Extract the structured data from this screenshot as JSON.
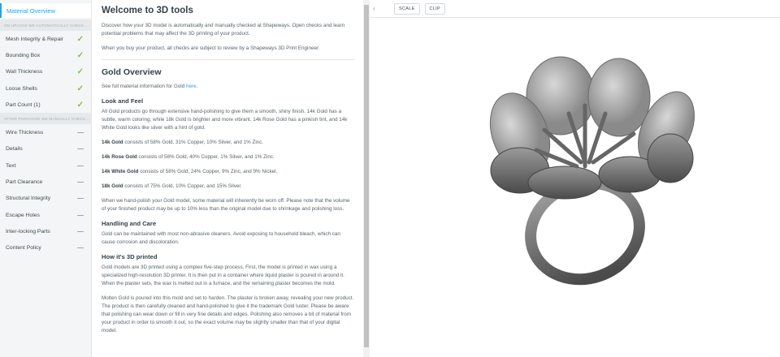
{
  "sidebar": {
    "active": "Material Overview",
    "section1": "ON UPLOAD WE AUTOMATICALLY CHECK...",
    "auto": [
      "Mesh Integrity & Repair",
      "Bounding Box",
      "Wall Thickness",
      "Loose Shells",
      "Part Count (1)"
    ],
    "section2": "AFTER PURCHASE WE MANUALLY CHECK...",
    "manual": [
      "Wire Thickness",
      "Details",
      "Text",
      "Part Clearance",
      "Structural Integrity",
      "Escape Holes",
      "Inter-locking Parts",
      "Content Policy"
    ]
  },
  "content": {
    "title": "Welcome to 3D tools",
    "intro1": "Discover how your 3D model is automatically and manually checked at Shapeways. Open checks and learn potential problems that may affect the 3D printing of your product.",
    "intro2": "When you buy your product, all checks are subject to review by a Shapeways 3D Print Engineer.",
    "overview_title": "Gold Overview",
    "see_full": "See full material information for Gold ",
    "here": "here",
    "look_title": "Look and Feel",
    "look": "All Gold products go through extensive hand-polishing to give them a smooth, shiny finish. 14k Gold has a subtle, warm coloring, while 18k Gold is brighter and more vibrant. 14k Rose Gold has a pinkish tint, and 14k White Gold looks like silver with a hint of gold.",
    "alloys": [
      {
        "name": "14k Gold",
        "desc": " consists of 58% Gold, 31% Copper, 10% Silver, and 1% Zinc."
      },
      {
        "name": "14k Rose Gold",
        "desc": " consists of 58% Gold, 40% Copper, 1% Silver, and 1% Zinc."
      },
      {
        "name": "14k White Gold",
        "desc": " consists of 58% Gold, 24% Copper, 9% Zinc, and 9% Nickel."
      },
      {
        "name": "18k Gold",
        "desc": " consists of 75% Gold, 10% Copper, and 15% Silver."
      }
    ],
    "polish": "When we hand-polish your Gold model, some material will inherently be worn off. Please note that the volume of your finished product may be up to 10% less than the original model due to shrinkage and polishing loss.",
    "care_title": "Handling and Care",
    "care": "Gold can be maintained with most non-abrasive cleaners. Avoid exposing to household bleach, which can cause corrosion and discoloration.",
    "printed_title": "How it's 3D printed",
    "printed1": "Gold models are 3D printed using a complex five-step process. First, the model is printed in wax using a specialized high-resolution 3D printer. It is then put in a container where liquid plaster is poured in around it. When the plaster sets, the wax is melted out in a furnace, and the remaining plaster becomes the mold.",
    "printed2": "Molten Gold is poured into this mold and set to harden. The plaster is broken away, revealing your new product. The product is then carefully cleaned and hand-polished to give it the trademark Gold luster. Please be aware that polishing can wear down or fill in very fine details and edges. Polishing also removes a bit of material from your product in order to smooth it out, so the exact volume may be slightly smaller than that of your digital model."
  },
  "viewer": {
    "collapse": "‹",
    "scale": "SCALE",
    "clip": "CLIP"
  }
}
